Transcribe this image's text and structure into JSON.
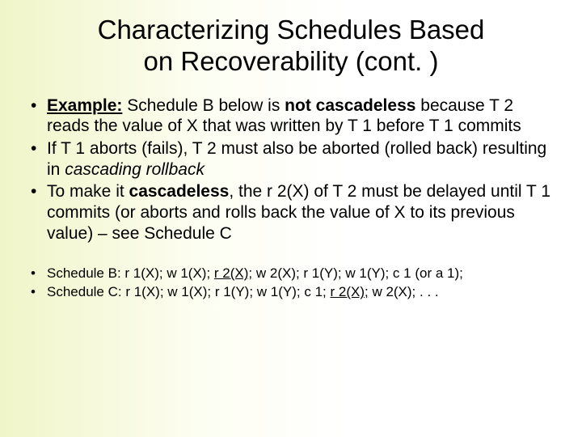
{
  "title_line1": "Characterizing Schedules Based",
  "title_line2": "on Recoverability (cont. )",
  "bullets": [
    {
      "pre": "",
      "seg1": "Example:",
      "mid1": " Schedule B below is ",
      "seg2": "not cascadeless",
      "mid2": " because T 2 reads the value of X that was written by T 1 before T 1 commits"
    },
    {
      "pre": "If T 1 aborts (fails), T 2 must also be aborted (rolled back) resulting in ",
      "seg1": "cascading rollback",
      "mid1": "",
      "seg2": "",
      "mid2": ""
    },
    {
      "pre": "To make it ",
      "seg1": "cascadeless",
      "mid1": ", the r 2(X) of T 2 must be delayed until T 1 commits (or aborts and rolls back the value of X to its previous value) – see Schedule C",
      "seg2": "",
      "mid2": ""
    }
  ],
  "schedules": [
    {
      "label": "Schedule B: r 1(X); w 1(X); ",
      "emph": "r 2(X);",
      "rest": " w 2(X); r 1(Y); w 1(Y); c 1 (or a 1);"
    },
    {
      "label": "Schedule C: r 1(X); w 1(X); r 1(Y); w 1(Y); c 1; ",
      "emph": "r 2(X);",
      "rest": " w 2(X); . . ."
    }
  ]
}
